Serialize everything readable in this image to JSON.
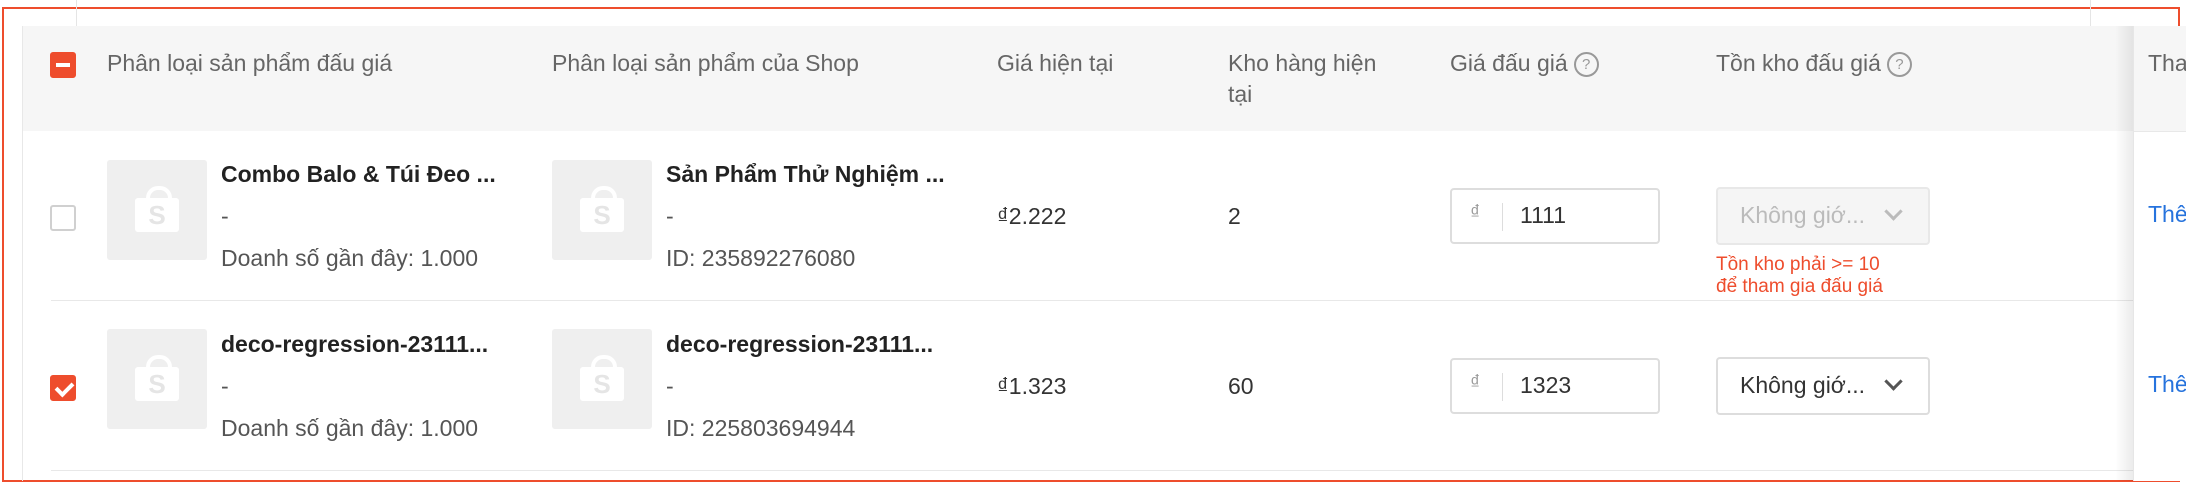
{
  "header": {
    "col_auction_variant": "Phân loại sản phẩm đấu giá",
    "col_shop_variant": "Phân loại sản phẩm của Shop",
    "col_current_price": "Giá hiện tại",
    "col_stock_line1": "Kho hàng hiện",
    "col_stock_line2": "tại",
    "col_auction_price": "Giá đấu giá",
    "col_auction_stock": "Tồn kho đấu giá",
    "col_action": "Thao",
    "help_glyph": "?"
  },
  "rows": [
    {
      "checked": false,
      "auction_name": "Combo Balo & Túi Đeo ...",
      "auction_sub": "-",
      "auction_sales": "Doanh số gần đây: 1.000",
      "shop_name": "Sản Phẩm Thử Nghiệm ...",
      "shop_sub": "-",
      "shop_id": "ID: 235892276080",
      "current_price": "₫2.222",
      "stock": "2",
      "currency": "₫",
      "auction_price": "1111",
      "auction_stock_select": "Không giớ...",
      "auction_stock_disabled": true,
      "error_line1": "Tồn kho phải >= 10",
      "error_line2": "để tham gia đấu giá",
      "action": "Thên"
    },
    {
      "checked": true,
      "auction_name": "deco-regression-23111...",
      "auction_sub": "-",
      "auction_sales": "Doanh số gần đây: 1.000",
      "shop_name": "deco-regression-23111...",
      "shop_sub": "-",
      "shop_id": "ID: 225803694944",
      "current_price": "₫1.323",
      "stock": "60",
      "currency": "₫",
      "auction_price": "1323",
      "auction_stock_select": "Không giớ...",
      "auction_stock_disabled": false,
      "action": "Thên"
    }
  ],
  "thumb_glyph": "S",
  "colors": {
    "accent": "#ee4d2d",
    "link": "#2673dd",
    "header_bg": "#f6f6f6"
  }
}
